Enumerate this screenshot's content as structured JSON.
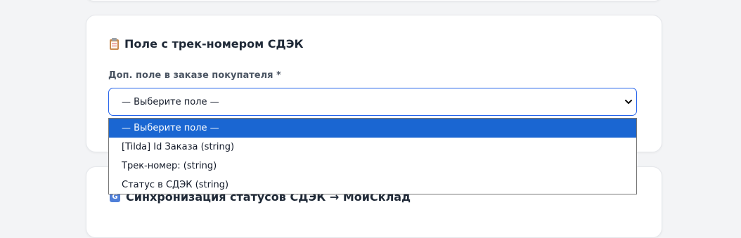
{
  "section": {
    "title": "Поле с трек-номером СДЭК",
    "icon": "clipboard-icon"
  },
  "field": {
    "label": "Доп. поле в заказе покупателя *",
    "selected_value": "— Выберите поле —",
    "options": [
      "— Выберите поле —",
      "[Tilda] Id Заказа (string)",
      "Трек-номер: (string)",
      "Статус в СДЭК (string)"
    ],
    "highlighted_index": 0
  },
  "next_section": {
    "title": "Синхронизация статусов СДЭК → МойСклад",
    "icon": "sync-icon"
  },
  "colors": {
    "accent": "#2563eb",
    "highlight": "#1a66d2",
    "background": "#f3f4f6"
  }
}
